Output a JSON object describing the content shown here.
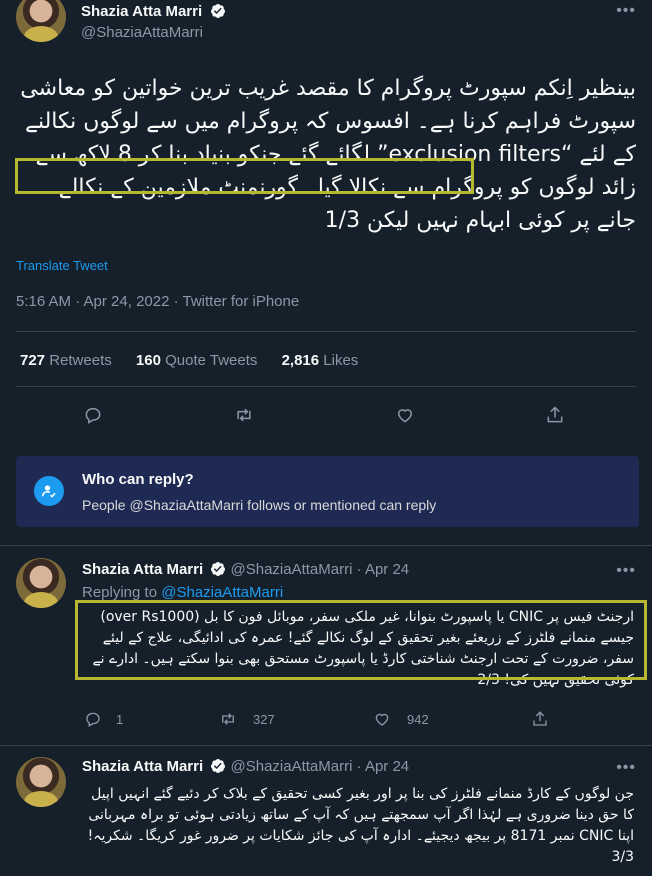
{
  "main_tweet": {
    "author_name": "Shazia Atta Marri",
    "handle": "@ShaziaAttaMarri",
    "text": "بینظیر اِنکم سپورٹ پروگرام کا مقصد غریب ترین خواتین کو معاشی سپورٹ فراہم کرنا ہے۔ افسوس کہ پروگرام میں سے لوگوں نکالنے کے لئے “exclusion filters” لگائے گئے جنکو بنیاد بنا کر 8 لاکھ سے زائد لوگوں کو پروگرام سے نکالا گیا۔ گورنمنٹ ملازمین کے نکالے جانے پر کوئی ابہام نہیں لیکن 1/3",
    "translate_label": "Translate Tweet",
    "timestamp": "5:16 AM · Apr 24, 2022 · Twitter for iPhone",
    "retweets_count": "727",
    "retweets_label": "Retweets",
    "quotes_count": "160",
    "quotes_label": "Quote Tweets",
    "likes_count": "2,816",
    "likes_label": "Likes"
  },
  "who_can_reply": {
    "title": "Who can reply?",
    "description": "People @ShaziaAttaMarri follows or mentioned can reply"
  },
  "replies": [
    {
      "author_name": "Shazia Atta Marri",
      "handle": "@ShaziaAttaMarri",
      "date": "· Apr 24",
      "replying_label": "Replying to",
      "replying_handle": "@ShaziaAttaMarri",
      "text": "ارجنٹ فیس پر CNIC یا پاسپورٹ بنوانا، غیر ملکی سفر، موبائل فون کا بل (over Rs1000) جیسے منمانے فلٹرز کے زریعئے بغیر تحقیق کے لوگ نکالے گئے! عمرہ کی ادائیگی، علاج کے لیئے سفر، ضرورت کے تحت ارجنٹ شناختی کارڈ یا پاسپورٹ مستحق بھی بنوا سکتے ہیں۔ ادارے نے کوئی تحقیق نہیں کی! 2/3",
      "reply_count": "1",
      "retweet_count": "327",
      "like_count": "942"
    },
    {
      "author_name": "Shazia Atta Marri",
      "handle": "@ShaziaAttaMarri",
      "date": "· Apr 24",
      "text": "جن لوگوں کے کارڈ منمانے فلٹرز کی بنا پر اور بغیر کسی تحقیق کے بلاک کر دئیے گئے انہیں اپیل کا حق دینا ضروری ہے لہٰذا اگر آپ سمجھتے ہیں کہ آپ کے ساتھ زیادتی ہوئی تو براہ مہربانی اپنا CNIC نمبر 8171 پر بیجھ دیجیئے۔ ادارہ آپ کی جائز شکایات پر ضرور غور کریگا۔ شکریہ! 3/3"
    }
  ],
  "colors": {
    "background": "#15202b",
    "accent": "#1d9bf0",
    "highlight": "#b7b732",
    "who_box": "#1e2a53"
  }
}
